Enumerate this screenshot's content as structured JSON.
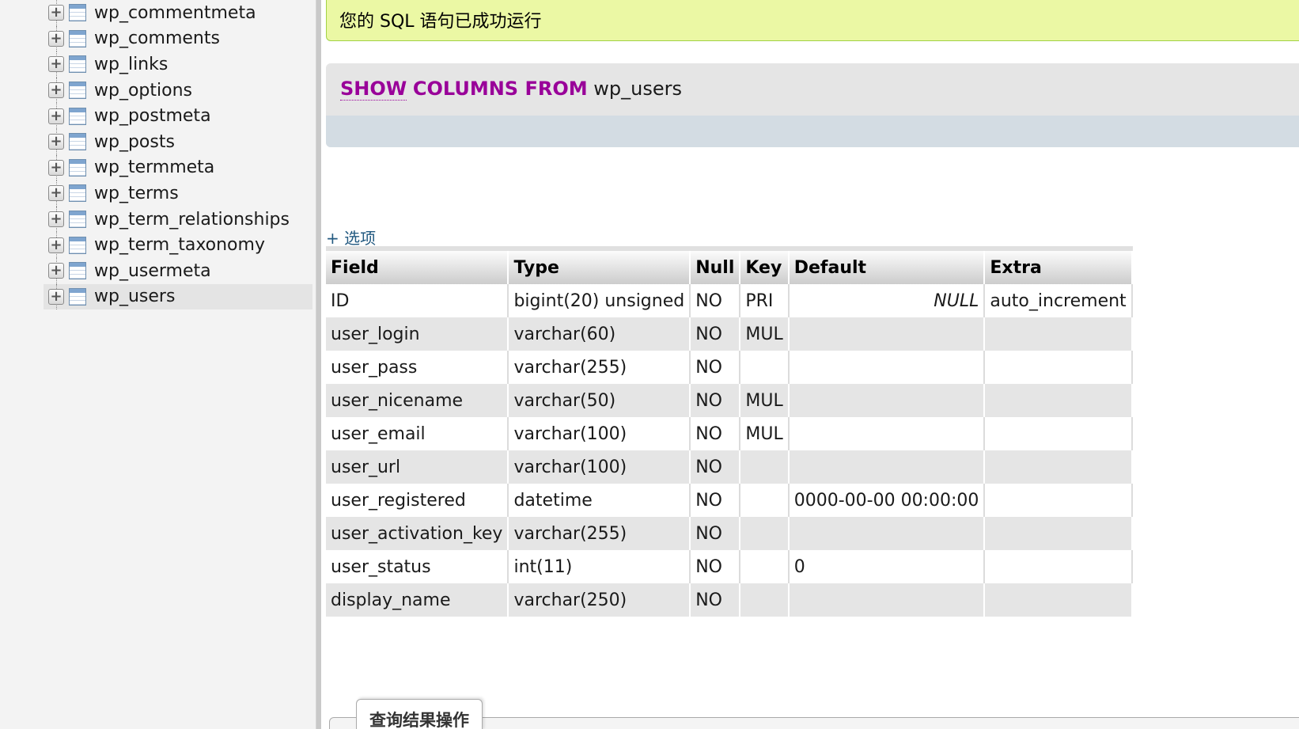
{
  "nav": {
    "tables": [
      {
        "name": "wp_commentmeta"
      },
      {
        "name": "wp_comments"
      },
      {
        "name": "wp_links"
      },
      {
        "name": "wp_options"
      },
      {
        "name": "wp_postmeta"
      },
      {
        "name": "wp_posts"
      },
      {
        "name": "wp_termmeta"
      },
      {
        "name": "wp_terms"
      },
      {
        "name": "wp_term_relationships"
      },
      {
        "name": "wp_term_taxonomy"
      },
      {
        "name": "wp_usermeta"
      },
      {
        "name": "wp_users",
        "active": true
      }
    ],
    "expander_glyph": "+"
  },
  "message": {
    "success": "您的 SQL 语句已成功运行"
  },
  "sql": {
    "kw_show": "SHOW",
    "kw_columns_from": "COLUMNS FROM",
    "table": "wp_users"
  },
  "options_link": "+ 选项",
  "results": {
    "columns": [
      "Field",
      "Type",
      "Null",
      "Key",
      "Default",
      "Extra"
    ],
    "rows": [
      [
        "ID",
        "bigint(20) unsigned",
        "NO",
        "PRI",
        "NULL",
        "auto_increment"
      ],
      [
        "user_login",
        "varchar(60)",
        "NO",
        "MUL",
        "",
        ""
      ],
      [
        "user_pass",
        "varchar(255)",
        "NO",
        "",
        "",
        ""
      ],
      [
        "user_nicename",
        "varchar(50)",
        "NO",
        "MUL",
        "",
        ""
      ],
      [
        "user_email",
        "varchar(100)",
        "NO",
        "MUL",
        "",
        ""
      ],
      [
        "user_url",
        "varchar(100)",
        "NO",
        "",
        "",
        ""
      ],
      [
        "user_registered",
        "datetime",
        "NO",
        "",
        "0000-00-00 00:00:00",
        ""
      ],
      [
        "user_activation_key",
        "varchar(255)",
        "NO",
        "",
        "",
        ""
      ],
      [
        "user_status",
        "int(11)",
        "NO",
        "",
        "0",
        ""
      ],
      [
        "display_name",
        "varchar(250)",
        "NO",
        "",
        "",
        ""
      ]
    ]
  },
  "ops": {
    "legend": "查询结果操作"
  },
  "colors": {
    "keyword": "#990099",
    "link": "#235a81",
    "success_bg": "#ebf8a4",
    "success_border": "#a2d246"
  }
}
